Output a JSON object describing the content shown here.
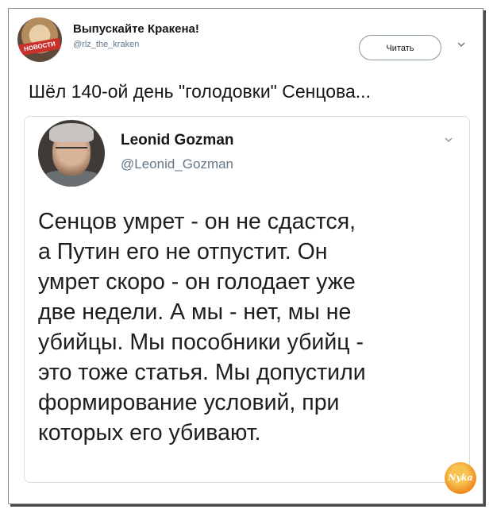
{
  "account": {
    "name": "Выпускайте Кракена!",
    "handle": "@rlz_the_kraken",
    "avatar_badge": "НОВОСТИ"
  },
  "follow_label": "Читать",
  "tweet": {
    "text": "Шёл 140-ой день \"голодовки\" Сенцова..."
  },
  "quote": {
    "name": "Leonid Gozman",
    "handle": "@Leonid_Gozman",
    "lines": [
      "Сенцов умрет - он не сдастся,",
      "а Путин его не отпустит. Он",
      "умрет скоро - он голодает уже",
      "две недели. А мы - нет, мы не",
      "убийцы. Мы пособники убийц -",
      "это тоже статья. Мы допустили",
      "формирование условий, при",
      "которых его убивают."
    ]
  },
  "watermark": "Nyka",
  "icons": {
    "tweet_menu": "chevron-down-icon",
    "quote_menu": "chevron-down-icon"
  },
  "colors": {
    "text_primary": "#14171a",
    "text_secondary": "#657786",
    "border": "#d3dde3"
  }
}
